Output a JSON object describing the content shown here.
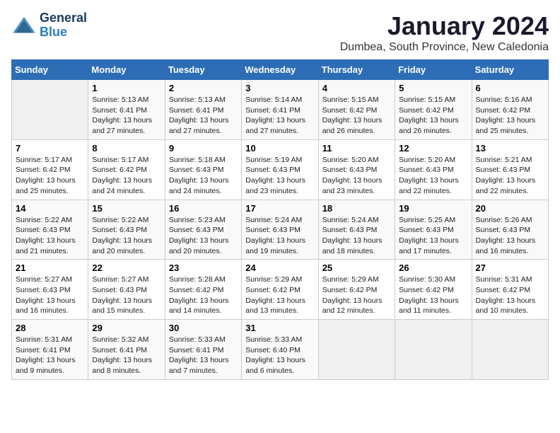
{
  "logo": {
    "line1": "General",
    "line2": "Blue"
  },
  "title": "January 2024",
  "location": "Dumbea, South Province, New Caledonia",
  "days_of_week": [
    "Sunday",
    "Monday",
    "Tuesday",
    "Wednesday",
    "Thursday",
    "Friday",
    "Saturday"
  ],
  "weeks": [
    [
      {
        "day": "",
        "info": ""
      },
      {
        "day": "1",
        "info": "Sunrise: 5:13 AM\nSunset: 6:41 PM\nDaylight: 13 hours\nand 27 minutes."
      },
      {
        "day": "2",
        "info": "Sunrise: 5:13 AM\nSunset: 6:41 PM\nDaylight: 13 hours\nand 27 minutes."
      },
      {
        "day": "3",
        "info": "Sunrise: 5:14 AM\nSunset: 6:41 PM\nDaylight: 13 hours\nand 27 minutes."
      },
      {
        "day": "4",
        "info": "Sunrise: 5:15 AM\nSunset: 6:42 PM\nDaylight: 13 hours\nand 26 minutes."
      },
      {
        "day": "5",
        "info": "Sunrise: 5:15 AM\nSunset: 6:42 PM\nDaylight: 13 hours\nand 26 minutes."
      },
      {
        "day": "6",
        "info": "Sunrise: 5:16 AM\nSunset: 6:42 PM\nDaylight: 13 hours\nand 25 minutes."
      }
    ],
    [
      {
        "day": "7",
        "info": "Sunrise: 5:17 AM\nSunset: 6:42 PM\nDaylight: 13 hours\nand 25 minutes."
      },
      {
        "day": "8",
        "info": "Sunrise: 5:17 AM\nSunset: 6:42 PM\nDaylight: 13 hours\nand 24 minutes."
      },
      {
        "day": "9",
        "info": "Sunrise: 5:18 AM\nSunset: 6:43 PM\nDaylight: 13 hours\nand 24 minutes."
      },
      {
        "day": "10",
        "info": "Sunrise: 5:19 AM\nSunset: 6:43 PM\nDaylight: 13 hours\nand 23 minutes."
      },
      {
        "day": "11",
        "info": "Sunrise: 5:20 AM\nSunset: 6:43 PM\nDaylight: 13 hours\nand 23 minutes."
      },
      {
        "day": "12",
        "info": "Sunrise: 5:20 AM\nSunset: 6:43 PM\nDaylight: 13 hours\nand 22 minutes."
      },
      {
        "day": "13",
        "info": "Sunrise: 5:21 AM\nSunset: 6:43 PM\nDaylight: 13 hours\nand 22 minutes."
      }
    ],
    [
      {
        "day": "14",
        "info": "Sunrise: 5:22 AM\nSunset: 6:43 PM\nDaylight: 13 hours\nand 21 minutes."
      },
      {
        "day": "15",
        "info": "Sunrise: 5:22 AM\nSunset: 6:43 PM\nDaylight: 13 hours\nand 20 minutes."
      },
      {
        "day": "16",
        "info": "Sunrise: 5:23 AM\nSunset: 6:43 PM\nDaylight: 13 hours\nand 20 minutes."
      },
      {
        "day": "17",
        "info": "Sunrise: 5:24 AM\nSunset: 6:43 PM\nDaylight: 13 hours\nand 19 minutes."
      },
      {
        "day": "18",
        "info": "Sunrise: 5:24 AM\nSunset: 6:43 PM\nDaylight: 13 hours\nand 18 minutes."
      },
      {
        "day": "19",
        "info": "Sunrise: 5:25 AM\nSunset: 6:43 PM\nDaylight: 13 hours\nand 17 minutes."
      },
      {
        "day": "20",
        "info": "Sunrise: 5:26 AM\nSunset: 6:43 PM\nDaylight: 13 hours\nand 16 minutes."
      }
    ],
    [
      {
        "day": "21",
        "info": "Sunrise: 5:27 AM\nSunset: 6:43 PM\nDaylight: 13 hours\nand 16 minutes."
      },
      {
        "day": "22",
        "info": "Sunrise: 5:27 AM\nSunset: 6:43 PM\nDaylight: 13 hours\nand 15 minutes."
      },
      {
        "day": "23",
        "info": "Sunrise: 5:28 AM\nSunset: 6:42 PM\nDaylight: 13 hours\nand 14 minutes."
      },
      {
        "day": "24",
        "info": "Sunrise: 5:29 AM\nSunset: 6:42 PM\nDaylight: 13 hours\nand 13 minutes."
      },
      {
        "day": "25",
        "info": "Sunrise: 5:29 AM\nSunset: 6:42 PM\nDaylight: 13 hours\nand 12 minutes."
      },
      {
        "day": "26",
        "info": "Sunrise: 5:30 AM\nSunset: 6:42 PM\nDaylight: 13 hours\nand 11 minutes."
      },
      {
        "day": "27",
        "info": "Sunrise: 5:31 AM\nSunset: 6:42 PM\nDaylight: 13 hours\nand 10 minutes."
      }
    ],
    [
      {
        "day": "28",
        "info": "Sunrise: 5:31 AM\nSunset: 6:41 PM\nDaylight: 13 hours\nand 9 minutes."
      },
      {
        "day": "29",
        "info": "Sunrise: 5:32 AM\nSunset: 6:41 PM\nDaylight: 13 hours\nand 8 minutes."
      },
      {
        "day": "30",
        "info": "Sunrise: 5:33 AM\nSunset: 6:41 PM\nDaylight: 13 hours\nand 7 minutes."
      },
      {
        "day": "31",
        "info": "Sunrise: 5:33 AM\nSunset: 6:40 PM\nDaylight: 13 hours\nand 6 minutes."
      },
      {
        "day": "",
        "info": ""
      },
      {
        "day": "",
        "info": ""
      },
      {
        "day": "",
        "info": ""
      }
    ]
  ]
}
